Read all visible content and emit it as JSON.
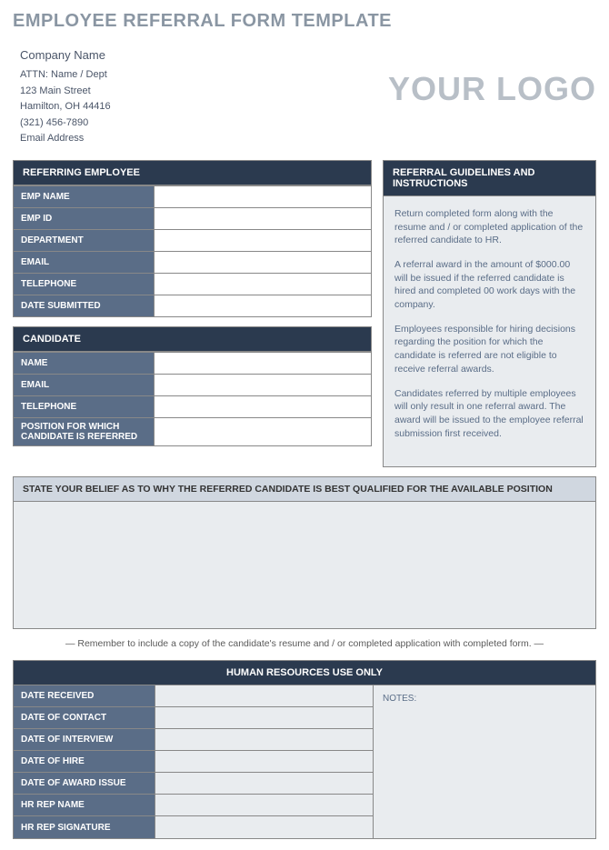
{
  "title": "EMPLOYEE REFERRAL FORM TEMPLATE",
  "company": {
    "name": "Company Name",
    "attn": "ATTN: Name / Dept",
    "street": "123 Main Street",
    "citystate": "Hamilton, OH  44416",
    "phone": "(321) 456-7890",
    "email": "Email Address"
  },
  "logo": "YOUR LOGO",
  "sections": {
    "referring": {
      "header": "REFERRING EMPLOYEE",
      "fields": [
        "EMP NAME",
        "EMP ID",
        "DEPARTMENT",
        "EMAIL",
        "TELEPHONE",
        "DATE SUBMITTED"
      ]
    },
    "candidate": {
      "header": "CANDIDATE",
      "fields": [
        "NAME",
        "EMAIL",
        "TELEPHONE",
        "POSITION FOR WHICH CANDIDATE IS REFERRED"
      ]
    },
    "guidelines": {
      "header": "REFERRAL GUIDELINES AND INSTRUCTIONS",
      "p1": "Return completed form along with the resume and / or completed application of the referred candidate to HR.",
      "p2": "A referral award in the amount of $000.00 will be issued if the referred candidate is hired and completed 00 work days with the company.",
      "p3": "Employees responsible for hiring decisions regarding the position for which the candidate is referred are not eligible to receive referral awards.",
      "p4": "Candidates referred by multiple employees will only result in one referral award.  The award will be issued to the employee referral submission first received."
    },
    "qualification": {
      "header": "STATE YOUR BELIEF AS TO WHY THE REFERRED CANDIDATE IS BEST QUALIFIED FOR THE AVAILABLE POSITION"
    },
    "reminder": "— Remember to include a copy of the candidate's resume and / or completed application with completed form. —",
    "hr": {
      "header": "HUMAN RESOURCES USE ONLY",
      "fields": [
        "DATE RECEIVED",
        "DATE OF CONTACT",
        "DATE OF INTERVIEW",
        "DATE OF HIRE",
        "DATE OF AWARD ISSUE",
        "HR REP NAME",
        "HR REP SIGNATURE"
      ],
      "notes_label": "NOTES:"
    }
  }
}
